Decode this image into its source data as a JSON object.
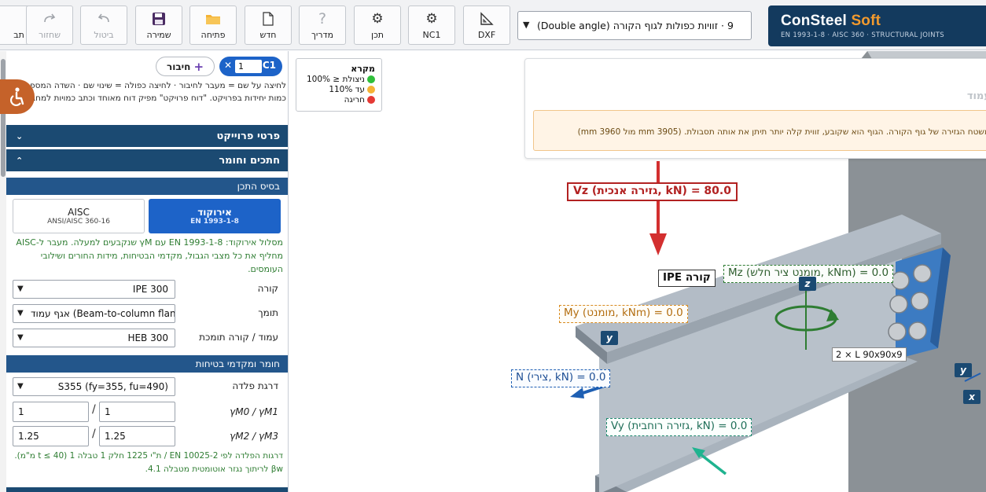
{
  "toolbar": {
    "buttons": [
      {
        "key": "dxf",
        "label": "DXF",
        "icon": "ruler-triangle-icon",
        "enabled": true
      },
      {
        "key": "nc1",
        "label": "NC1",
        "icon": "gear-icon",
        "enabled": true
      },
      {
        "key": "content",
        "label": "תכן",
        "icon": "gear-icon",
        "enabled": true
      },
      {
        "key": "guide",
        "label": "מדריך",
        "icon": "question-icon",
        "enabled": true
      },
      {
        "key": "new",
        "label": "חדש",
        "icon": "new-file-icon",
        "enabled": true
      },
      {
        "key": "open",
        "label": "פתיחה",
        "icon": "folder-icon",
        "enabled": true
      },
      {
        "key": "save",
        "label": "שמירה",
        "icon": "floppy-disk-icon",
        "enabled": true
      },
      {
        "key": "undo",
        "label": "ביטול",
        "icon": "undo-icon",
        "enabled": false
      },
      {
        "key": "redo",
        "label": "שחזור",
        "icon": "redo-icon",
        "enabled": false
      },
      {
        "key": "partial",
        "label": "תב",
        "icon": "",
        "enabled": true
      }
    ],
    "preset_select": "9 · זוויות כפולות לגוף הקורה (Double angle)"
  },
  "brand": {
    "name": "ConSteel",
    "name_accent": "Soft",
    "subtitle": "EN 1993-1-8 · AISC 360 · STRUCTURAL JOINTS"
  },
  "connection": {
    "id": "C1",
    "quantity": "1",
    "add_label": "חיבור"
  },
  "hint_text": "לחיצה על שם = מעבר לחיבור · לחיצה כפולה = שינוי שם · השדה המספרי = כמות יחידות בפרויקט. \"דוח פרויקט\" מפיק דוח מאוחד וכתב כמויות למחברים.",
  "sections": {
    "project": "פרטי פרוייקט",
    "design": "חתכים וחומר"
  },
  "design_basis": {
    "title": "בסיס התכן",
    "standards": [
      {
        "label": "אירוקוד",
        "sub": "EN 1993-1-8",
        "active": true
      },
      {
        "label": "AISC",
        "sub": "ANSI/AISC 360-16",
        "active": false
      }
    ],
    "note": "מסלול אירוקוד: EN 1993-1-8 עם γM שנקבעים למעלה. מעבר ל-AISC מחליף את כל מצבי הגבול, מקדמי הבטיחות, מידות החורים ושילובי העומסים."
  },
  "members": [
    {
      "label": "קורה",
      "value": "IPE 300"
    },
    {
      "label": "תומך",
      "value": "אגף עמוד (Beam-to-column flange)"
    },
    {
      "label": "עמוד / קורה תומכת",
      "value": "HEB 300"
    }
  ],
  "material": {
    "title": "חומר ומקדמי בטיחות",
    "grade_label": "דרגת פלדה",
    "grade_value": "S355 (fy=355, fu=490)",
    "gamma_01_label": "γM0 / γM1",
    "gamma_m0": "1",
    "gamma_m1": "1",
    "gamma_23_label": "γM2 / γM3",
    "gamma_m2": "1.25",
    "gamma_m3": "1.25",
    "note": "דרגות הפלדה לפי EN 10025-2 / ת\"י 1225 חלק 1 טבלה 1 (t ≤ 40 מ\"מ). βw לריתוך נגזר אוטומטית מטבלה 4.1."
  },
  "legend": {
    "title": "מקרא",
    "items": [
      {
        "label": "ניצולת ≤ 100%",
        "color": "#2fbf3a"
      },
      {
        "label": "עד 110%",
        "color": "#f5b335"
      },
      {
        "label": "חריגה",
        "color": "#e53935"
      }
    ]
  },
  "view": {
    "tip_text": "משטח הגזירה של גוף הקורה. הגוף הוא שקובע, זווית קלה יותר תיתן את אותה תסבולת. (3905 mm מול 3960 mm)",
    "column_label": "עמוד",
    "beam_label": "קורה IPE",
    "angle_label": "2 × L 90x90x9",
    "loads": {
      "vz": "Vz (גזירה אנכית, kN) = 80.0",
      "mz": "Mz (מומנט ציר חלש, kNm) = 0.0",
      "my": "My (מומנט, kNm) = 0.0",
      "n": "N (צירי, kN) = 0.0",
      "vy": "Vy (גזירה רוחבית, kN) = 0.0"
    },
    "axes": {
      "z": "z",
      "y": "y",
      "x": "x"
    },
    "colors": {
      "vz": "#c62828",
      "mz": "#2e7d32",
      "my": "#d88b1f",
      "n": "#1e5fb3",
      "vy": "#1fb38f"
    }
  }
}
